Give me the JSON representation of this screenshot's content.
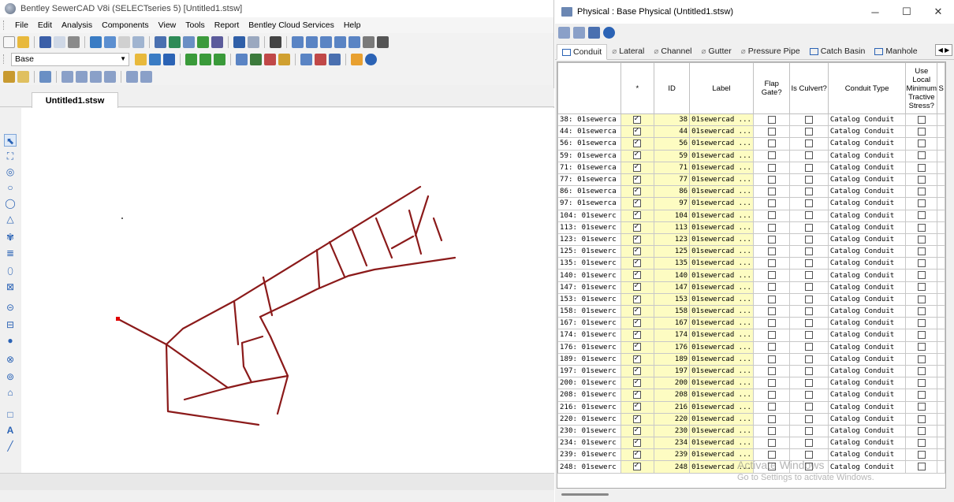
{
  "main_window": {
    "title": "Bentley SewerCAD V8i (SELECTseries 5) [Untitled1.stsw]",
    "menu": [
      "File",
      "Edit",
      "Analysis",
      "Components",
      "View",
      "Tools",
      "Report",
      "Bentley Cloud Services",
      "Help"
    ],
    "scenario": "Base",
    "document_tab": "Untitled1.stsw"
  },
  "colors": {
    "pipe": "#8b1a1a",
    "selected_node": "#e00000",
    "catalog_cell": "#fdfcc2",
    "accent": "#2b63b5"
  },
  "palette_icons": [
    "select-icon",
    "multi-select-icon",
    "manhole-icon",
    "junction-icon",
    "outfall-icon",
    "wet-well-icon",
    "pump-icon",
    "storage-icon",
    "catch-basin-icon",
    "cross-section-icon",
    "inlet-icon",
    "tank-icon",
    "node-icon",
    "gutter-icon",
    "pressure-junction-icon",
    "valve-icon",
    "border-icon",
    "text-icon",
    "line-icon"
  ],
  "physical": {
    "title": "Physical : Base Physical (Untitled1.stsw)",
    "tabs": [
      {
        "label": "Conduit",
        "icon": "conduit-icon"
      },
      {
        "label": "Lateral",
        "icon": "lateral-icon"
      },
      {
        "label": "Channel",
        "icon": "channel-icon"
      },
      {
        "label": "Gutter",
        "icon": "gutter-icon"
      },
      {
        "label": "Pressure Pipe",
        "icon": "pressure-pipe-icon"
      },
      {
        "label": "Catch Basin",
        "icon": "catch-basin-icon"
      },
      {
        "label": "Manhole",
        "icon": "manhole-icon"
      }
    ],
    "columns": [
      "",
      "*",
      "ID",
      "Label",
      "Flap Gate?",
      "Is Culvert?",
      "Conduit Type",
      "Use Local Minimum Tractive Stress?",
      "S"
    ],
    "rows": [
      {
        "rowhdr": "38: 01sewerca",
        "id": "38",
        "label": "01sewercad ...",
        "conduit_type": "Catalog Conduit"
      },
      {
        "rowhdr": "44: 01sewerca",
        "id": "44",
        "label": "01sewercad ...",
        "conduit_type": "Catalog Conduit"
      },
      {
        "rowhdr": "56: 01sewerca",
        "id": "56",
        "label": "01sewercad ...",
        "conduit_type": "Catalog Conduit"
      },
      {
        "rowhdr": "59: 01sewerca",
        "id": "59",
        "label": "01sewercad ...",
        "conduit_type": "Catalog Conduit"
      },
      {
        "rowhdr": "71: 01sewerca",
        "id": "71",
        "label": "01sewercad ...",
        "conduit_type": "Catalog Conduit"
      },
      {
        "rowhdr": "77: 01sewerca",
        "id": "77",
        "label": "01sewercad ...",
        "conduit_type": "Catalog Conduit"
      },
      {
        "rowhdr": "86: 01sewerca",
        "id": "86",
        "label": "01sewercad ...",
        "conduit_type": "Catalog Conduit"
      },
      {
        "rowhdr": "97: 01sewerca",
        "id": "97",
        "label": "01sewercad ...",
        "conduit_type": "Catalog Conduit"
      },
      {
        "rowhdr": "104: 01sewerc",
        "id": "104",
        "label": "01sewercad ...",
        "conduit_type": "Catalog Conduit"
      },
      {
        "rowhdr": "113: 01sewerc",
        "id": "113",
        "label": "01sewercad ...",
        "conduit_type": "Catalog Conduit"
      },
      {
        "rowhdr": "123: 01sewerc",
        "id": "123",
        "label": "01sewercad ...",
        "conduit_type": "Catalog Conduit"
      },
      {
        "rowhdr": "125: 01sewerc",
        "id": "125",
        "label": "01sewercad ...",
        "conduit_type": "Catalog Conduit"
      },
      {
        "rowhdr": "135: 01sewerc",
        "id": "135",
        "label": "01sewercad ...",
        "conduit_type": "Catalog Conduit"
      },
      {
        "rowhdr": "140: 01sewerc",
        "id": "140",
        "label": "01sewercad ...",
        "conduit_type": "Catalog Conduit"
      },
      {
        "rowhdr": "147: 01sewerc",
        "id": "147",
        "label": "01sewercad ...",
        "conduit_type": "Catalog Conduit"
      },
      {
        "rowhdr": "153: 01sewerc",
        "id": "153",
        "label": "01sewercad ...",
        "conduit_type": "Catalog Conduit"
      },
      {
        "rowhdr": "158: 01sewerc",
        "id": "158",
        "label": "01sewercad ...",
        "conduit_type": "Catalog Conduit"
      },
      {
        "rowhdr": "167: 01sewerc",
        "id": "167",
        "label": "01sewercad ...",
        "conduit_type": "Catalog Conduit"
      },
      {
        "rowhdr": "174: 01sewerc",
        "id": "174",
        "label": "01sewercad ...",
        "conduit_type": "Catalog Conduit"
      },
      {
        "rowhdr": "176: 01sewerc",
        "id": "176",
        "label": "01sewercad ...",
        "conduit_type": "Catalog Conduit"
      },
      {
        "rowhdr": "189: 01sewerc",
        "id": "189",
        "label": "01sewercad ...",
        "conduit_type": "Catalog Conduit"
      },
      {
        "rowhdr": "197: 01sewerc",
        "id": "197",
        "label": "01sewercad ...",
        "conduit_type": "Catalog Conduit"
      },
      {
        "rowhdr": "200: 01sewerc",
        "id": "200",
        "label": "01sewercad ...",
        "conduit_type": "Catalog Conduit"
      },
      {
        "rowhdr": "208: 01sewerc",
        "id": "208",
        "label": "01sewercad ...",
        "conduit_type": "Catalog Conduit"
      },
      {
        "rowhdr": "216: 01sewerc",
        "id": "216",
        "label": "01sewercad ...",
        "conduit_type": "Catalog Conduit"
      },
      {
        "rowhdr": "220: 01sewerc",
        "id": "220",
        "label": "01sewercad ...",
        "conduit_type": "Catalog Conduit"
      },
      {
        "rowhdr": "230: 01sewerc",
        "id": "230",
        "label": "01sewercad ...",
        "conduit_type": "Catalog Conduit"
      },
      {
        "rowhdr": "234: 01sewerc",
        "id": "234",
        "label": "01sewercad ...",
        "conduit_type": "Catalog Conduit"
      },
      {
        "rowhdr": "239: 01sewerc",
        "id": "239",
        "label": "01sewercad ...",
        "conduit_type": "Catalog Conduit"
      },
      {
        "rowhdr": "248: 01sewerc",
        "id": "248",
        "label": "01sewercad ...",
        "conduit_type": "Catalog Conduit"
      }
    ]
  },
  "watermark": {
    "line1": "Activate Windows",
    "line2": "Go to Settings to activate Windows."
  }
}
